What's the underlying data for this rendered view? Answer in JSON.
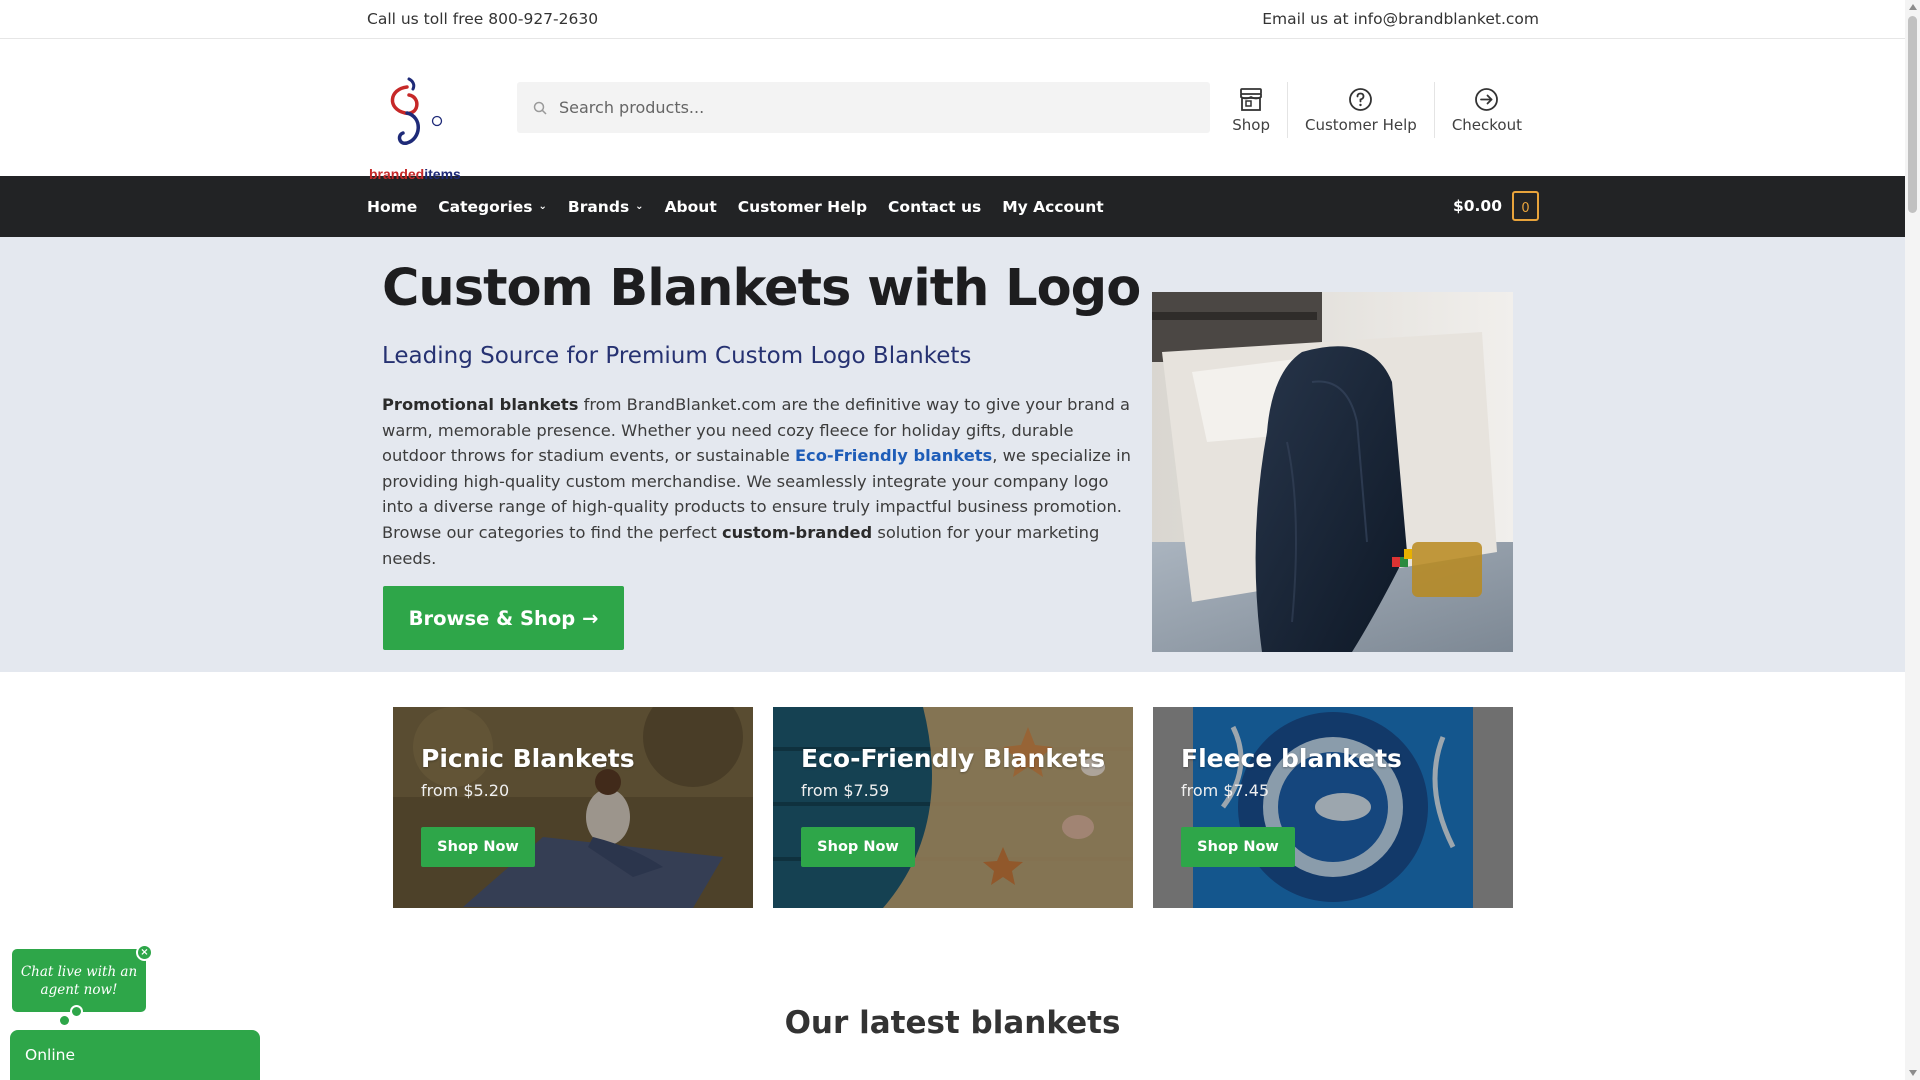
{
  "topbar": {
    "phone": "Call us toll free 800-927-2630",
    "email": "Email us at info@brandblanket.com"
  },
  "header": {
    "logo_brand": "branded",
    "logo_items": "items",
    "logo_reg": "®",
    "search_placeholder": "Search products...",
    "links": [
      {
        "label": "Shop",
        "icon": "store-icon"
      },
      {
        "label": "Customer Help",
        "icon": "question-circle-icon"
      },
      {
        "label": "Checkout",
        "icon": "arrow-right-circle-icon"
      }
    ]
  },
  "nav": {
    "items": [
      "Home",
      "Categories",
      "Brands",
      "About",
      "Customer Help",
      "Contact us",
      "My Account"
    ],
    "cart_total": "$0.00",
    "cart_count": "0"
  },
  "hero": {
    "title": "Custom Blankets with Logo",
    "subtitle": "Leading Source for Premium Custom Logo Blankets",
    "p1_bold": "Promotional blankets",
    "p1_text": " from BrandBlanket.com are the definitive way to give your brand a warm, memorable presence. Whether you need cozy fleece for holiday gifts, durable outdoor throws for stadium events, or sustainable ",
    "p1_link": "Eco-Friendly blankets",
    "p1_text2": ", we specialize in providing high-quality custom merchandise. We seamlessly integrate your company logo into a diverse range of high-quality products to ensure truly impactful business promotion. Browse our categories to find the perfect ",
    "p1_bold2": "custom-branded",
    "p1_text3": " solution for your marketing needs.",
    "button": "Browse & Shop →"
  },
  "categories": [
    {
      "title": "Picnic Blankets",
      "price": "from $5.20",
      "button": "Shop Now"
    },
    {
      "title": "Eco-Friendly Blankets",
      "price": "from $7.59",
      "button": "Shop Now"
    },
    {
      "title": "Fleece blankets",
      "price": "from $7.45",
      "button": "Shop Now"
    }
  ],
  "latest_heading": "Our latest blankets",
  "chat": {
    "bubble": "Chat live with an agent now!",
    "close": "×",
    "status": "Online"
  },
  "colors": {
    "accent_green": "#2ea649",
    "nav_dark": "#222325",
    "link_blue": "#1e5db8",
    "hero_bg": "#e4e8ef",
    "cart_orange": "#e8a33b"
  }
}
